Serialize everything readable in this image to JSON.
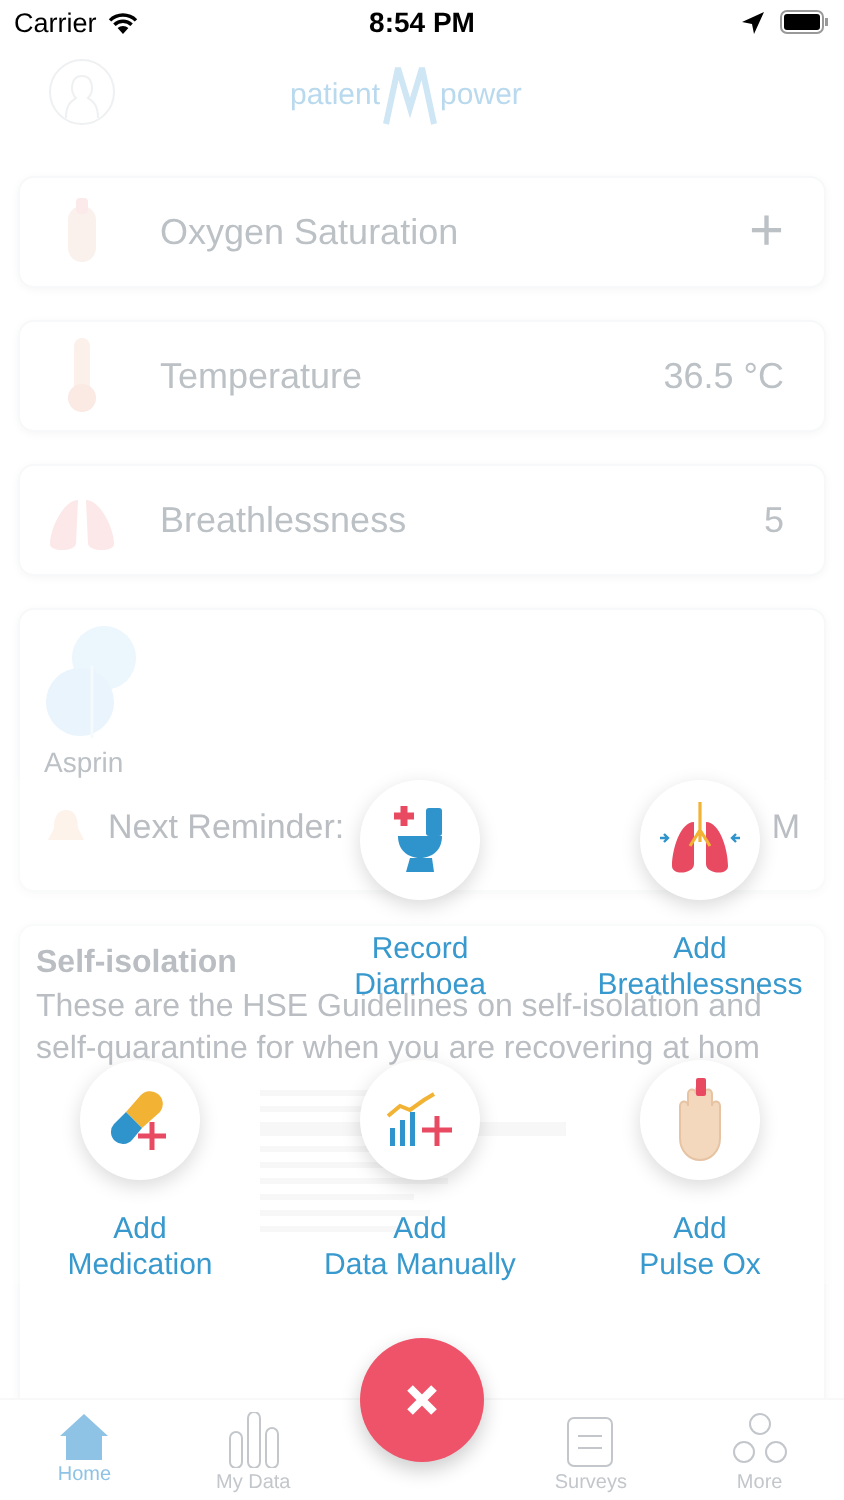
{
  "status_bar": {
    "carrier": "Carrier",
    "time": "8:54 PM"
  },
  "header": {
    "logo_left": "patient",
    "logo_right": "power"
  },
  "readings": [
    {
      "kind": "pulse",
      "label": "Oxygen Saturation",
      "value": "+"
    },
    {
      "kind": "temperature",
      "label": "Temperature",
      "value": "36.5 °C"
    },
    {
      "kind": "lungs",
      "label": "Breathlessness",
      "value": "5"
    }
  ],
  "medication": {
    "name": "Asprin",
    "reminder_label": "Next Reminder:",
    "reminder_time": "M"
  },
  "article": {
    "title": "Self-isolation",
    "text": "These are the HSE Guidelines on self-isolation and self-quarantine for when you are recovering at hom"
  },
  "actions": [
    {
      "kind": "toilet",
      "label": "Record\nDiarrhoea"
    },
    {
      "kind": "lungs",
      "label": "Add\nBreathlessness"
    },
    {
      "kind": "pill",
      "label": "Add\nMedication"
    },
    {
      "kind": "chart",
      "label": "Add\nData Manually"
    },
    {
      "kind": "hand",
      "label": "Add\nPulse Ox"
    }
  ],
  "tabs": [
    {
      "kind": "home",
      "label": "Home",
      "selected": true
    },
    {
      "kind": "data",
      "label": "My Data",
      "selected": false
    },
    {
      "kind": "surveys",
      "label": "Surveys",
      "selected": false
    },
    {
      "kind": "more",
      "label": "More",
      "selected": false
    }
  ]
}
